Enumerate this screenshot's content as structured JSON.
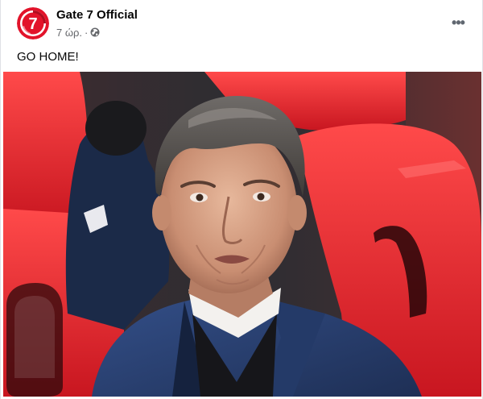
{
  "post": {
    "page_name": "Gate 7 Official",
    "timestamp": "7 ώρ.",
    "separator": "·",
    "audience_icon": "globe-icon",
    "more_icon": "more-options-icon",
    "more_label": "•••",
    "text": "GO HOME!",
    "avatar": {
      "icon": "gate7-logo-icon",
      "logo_char": "7"
    },
    "photo": {
      "icon": "photo-image",
      "subject": "coach-portrait"
    }
  },
  "colors": {
    "brand_red": "#e2132a",
    "seat_red": "#e8262f",
    "text_primary": "#050505",
    "text_secondary": "#65676b",
    "jacket_blue": "#2a3f6e"
  }
}
